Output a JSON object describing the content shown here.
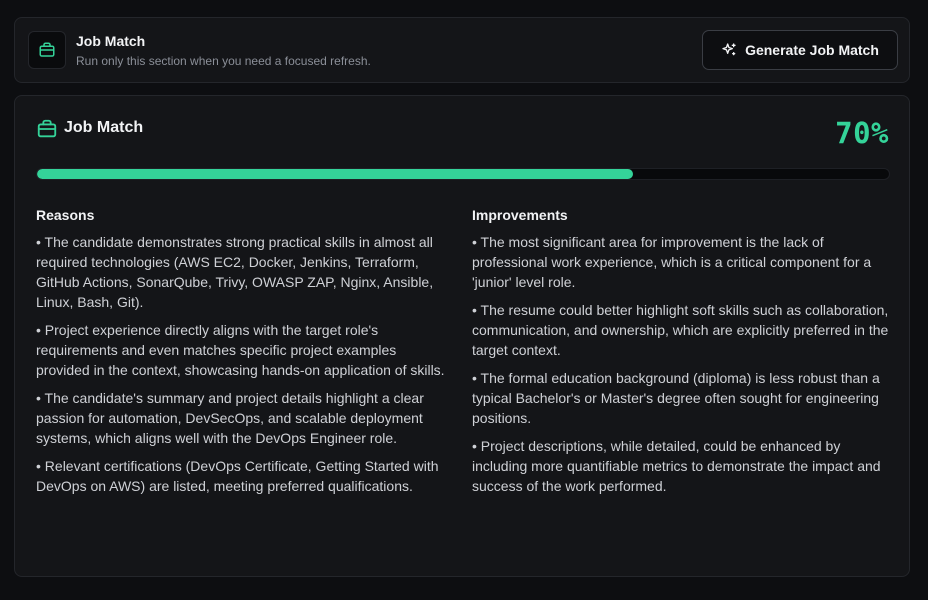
{
  "header": {
    "icon": "briefcase-icon",
    "title": "Job Match",
    "subtitle": "Run only this section when you need a focused refresh.",
    "button_label": "Generate Job Match",
    "button_icon": "sparkles-icon"
  },
  "main": {
    "icon": "briefcase-icon",
    "title": "Job Match",
    "score_label": "70%",
    "score_fraction": 0.7,
    "accent_color": "#34d399",
    "reasons": {
      "heading": "Reasons",
      "items": [
        "• The candidate demonstrates strong practical skills in almost all required technologies (AWS EC2, Docker, Jenkins, Terraform, GitHub Actions, SonarQube, Trivy, OWASP ZAP, Nginx, Ansible, Linux, Bash, Git).",
        "• Project experience directly aligns with the target role's requirements and even matches specific project examples provided in the context, showcasing hands-on application of skills.",
        "• The candidate's summary and project details highlight a clear passion for automation, DevSecOps, and scalable deployment systems, which aligns well with the DevOps Engineer role.",
        "• Relevant certifications (DevOps Certificate, Getting Started with DevOps on AWS) are listed, meeting preferred qualifications."
      ]
    },
    "improvements": {
      "heading": "Improvements",
      "items": [
        "• The most significant area for improvement is the lack of professional work experience, which is a critical component for a 'junior' level role.",
        "• The resume could better highlight soft skills such as collaboration, communication, and ownership, which are explicitly preferred in the target context.",
        "• The formal education background (diploma) is less robust than a typical Bachelor's or Master's degree often sought for engineering positions.",
        "• Project descriptions, while detailed, could be enhanced by including more quantifiable metrics to demonstrate the impact and success of the work performed."
      ]
    }
  }
}
